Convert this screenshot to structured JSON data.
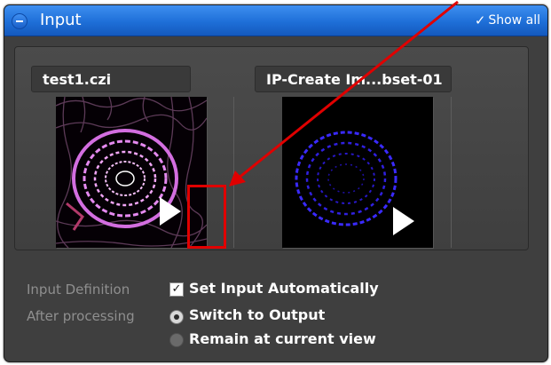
{
  "header": {
    "title": "Input",
    "show_all_label": "Show all",
    "show_all_checked": true
  },
  "inputs": [
    {
      "label": "test1.czi",
      "thumbnail": "magenta-cell-tissue-image"
    },
    {
      "label": "IP-Create Im...bset-01",
      "thumbnail": "blue-cell-ring-image"
    }
  ],
  "options": {
    "input_definition": {
      "label": "Input Definition",
      "checkbox_label": "Set Input Automatically",
      "checked": true
    },
    "after_processing": {
      "label": "After processing",
      "choices": [
        {
          "label": "Switch to Output",
          "selected": true
        },
        {
          "label": "Remain at current view",
          "selected": false
        }
      ]
    }
  },
  "annotation": {
    "color": "#e00000",
    "icon": "red-arrow"
  }
}
